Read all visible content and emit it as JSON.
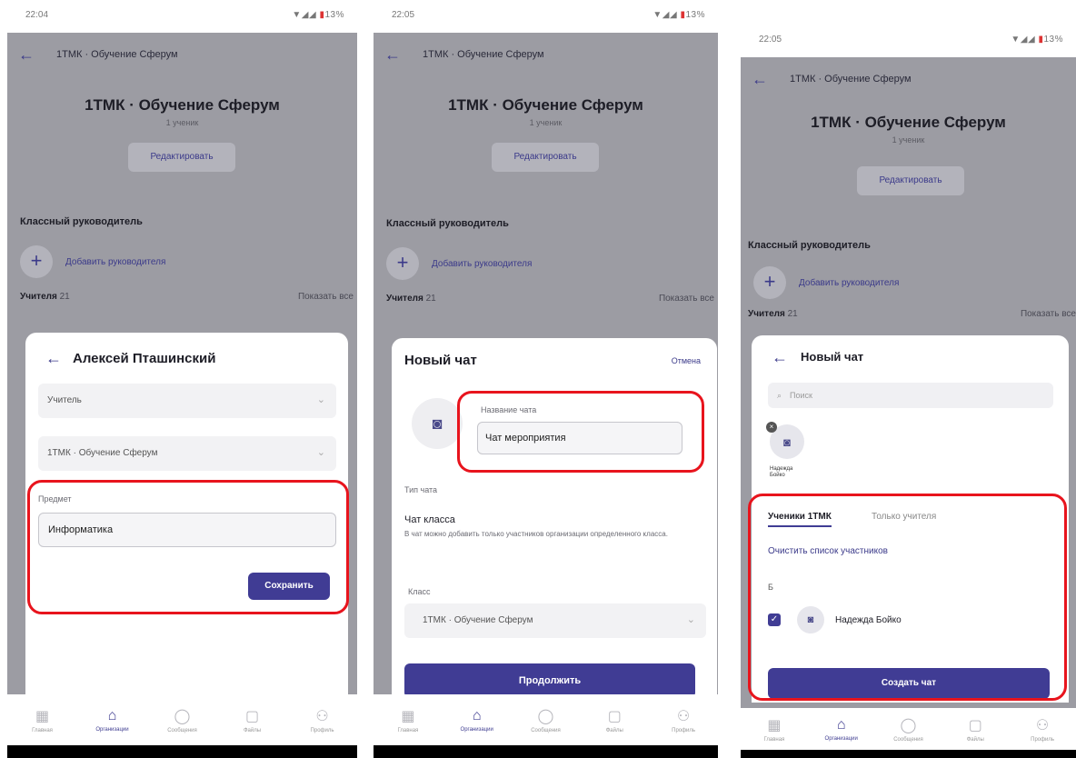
{
  "common": {
    "back_arrow": "←",
    "org_title": "1ТМК · Обучение Сферум",
    "hero_title": "1ТМК · Обучение Сферум",
    "hero_sub": "1 ученик",
    "edit_label": "Редактировать",
    "class_teacher_label": "Классный руководитель",
    "class_teacher_label_alt": "Класcный руководитель",
    "add_teacher_label": "Добавить руководителя",
    "teachers_label": "Учителя",
    "teachers_count": "21",
    "show_all": "Показать все",
    "nav": [
      {
        "label": "Главная",
        "icon": "grid-icon"
      },
      {
        "label": "Организации",
        "icon": "organization-icon"
      },
      {
        "label": "Сообщения",
        "icon": "chat-icon"
      },
      {
        "label": "Файлы",
        "icon": "file-icon"
      },
      {
        "label": "Профиль",
        "icon": "people-icon"
      }
    ],
    "status_sys": "▼◢◢",
    "status_battery": "13%"
  },
  "screen1": {
    "time": "22:04",
    "sheet_title": "Алексей Пташинский",
    "role_value": "Учитель",
    "class_value": "1ТМК · Обучение Сферум",
    "subject_label": "Предмет",
    "subject_value": "Информатика",
    "save_label": "Сохранить"
  },
  "screen2": {
    "time": "22:05",
    "sheet_title": "Новый чат",
    "cancel_label": "Отмена",
    "chat_name_label": "Название чата",
    "chat_name_value": "Чат мероприятия",
    "chat_type_label": "Тип чата",
    "chat_type_value": "Чат класса",
    "chat_type_desc": "В чат можно добавить только участников организации определенного класса.",
    "class_label": "Класс",
    "class_value": "1ТМК · Обучение Сферум",
    "continue_label": "Продолжить"
  },
  "screen3": {
    "time": "22:05",
    "sheet_title": "Новый чат",
    "search_placeholder": "Поиск",
    "selected_name_line1": "Надежда",
    "selected_name_line2": "Бойко",
    "tab_students": "Ученики 1ТМК",
    "tab_teachers": "Только учителя",
    "clear_label": "Очистить список участников",
    "group_letter": "Б",
    "member_name": "Надежда Бойко",
    "create_label": "Создать чат"
  }
}
